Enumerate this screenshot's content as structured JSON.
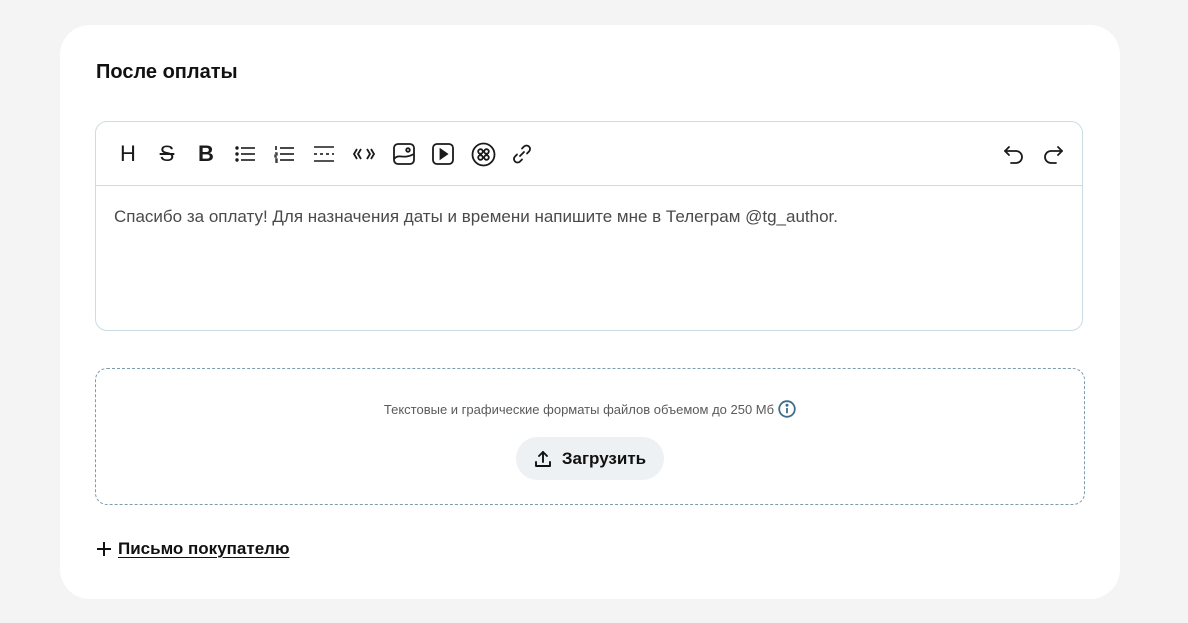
{
  "section": {
    "title": "После оплаты"
  },
  "editor": {
    "toolbar": {
      "heading_label": "H",
      "strike_label": "S",
      "bold_label": "B",
      "icons": [
        "heading-icon",
        "strikethrough-icon",
        "bold-icon",
        "bulleted-list-icon",
        "numbered-list-icon",
        "divider-icon",
        "quote-icon",
        "image-icon",
        "video-icon",
        "embed-icon",
        "link-icon",
        "undo-icon",
        "redo-icon"
      ]
    },
    "content": "Спасибо за оплату! Для назначения даты и времени напишите мне в Телеграм @tg_author."
  },
  "dropzone": {
    "hint": "Текстовые и графические форматы файлов объемом до 250 Мб",
    "upload_label": "Загрузить"
  },
  "add_letter": {
    "label": "Письмо покупателю"
  },
  "colors": {
    "background": "#f4f4f4",
    "card": "#ffffff",
    "border": "#c9dde3",
    "accent": "#3d6e8c",
    "button_bg": "#edf1f4"
  }
}
